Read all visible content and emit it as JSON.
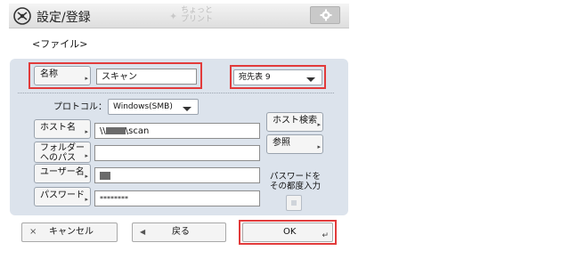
{
  "header": {
    "title": "設定/登録",
    "title_icon": "settings-register-icon",
    "center_logo_lines": [
      "ちょっと",
      "プリント"
    ],
    "corner_button_icon": "gear-icon"
  },
  "subtitle": "<ファイル>",
  "name_row": {
    "label": "名称",
    "value": "スキャン",
    "address_book": "宛先表 9"
  },
  "protocol": {
    "label": "プロトコル：",
    "value": "Windows(SMB)"
  },
  "host": {
    "label": "ホスト名",
    "value_prefix": "\\\\",
    "value_suffix": "\\scan",
    "search_button": "ホスト検索"
  },
  "folder": {
    "label_line1": "フォルダー",
    "label_line2": "へのパス",
    "value": "",
    "browse_button": "参照"
  },
  "user": {
    "label": "ユーザー名"
  },
  "password": {
    "label": "パスワード",
    "value": "********",
    "ask_line1": "パスワードを",
    "ask_line2": "その都度入力"
  },
  "footer": {
    "cancel": "キャンセル",
    "back": "戻る",
    "ok": "OK"
  },
  "colors": {
    "highlight": "#e23b3b",
    "panel": "#dce3ec"
  }
}
